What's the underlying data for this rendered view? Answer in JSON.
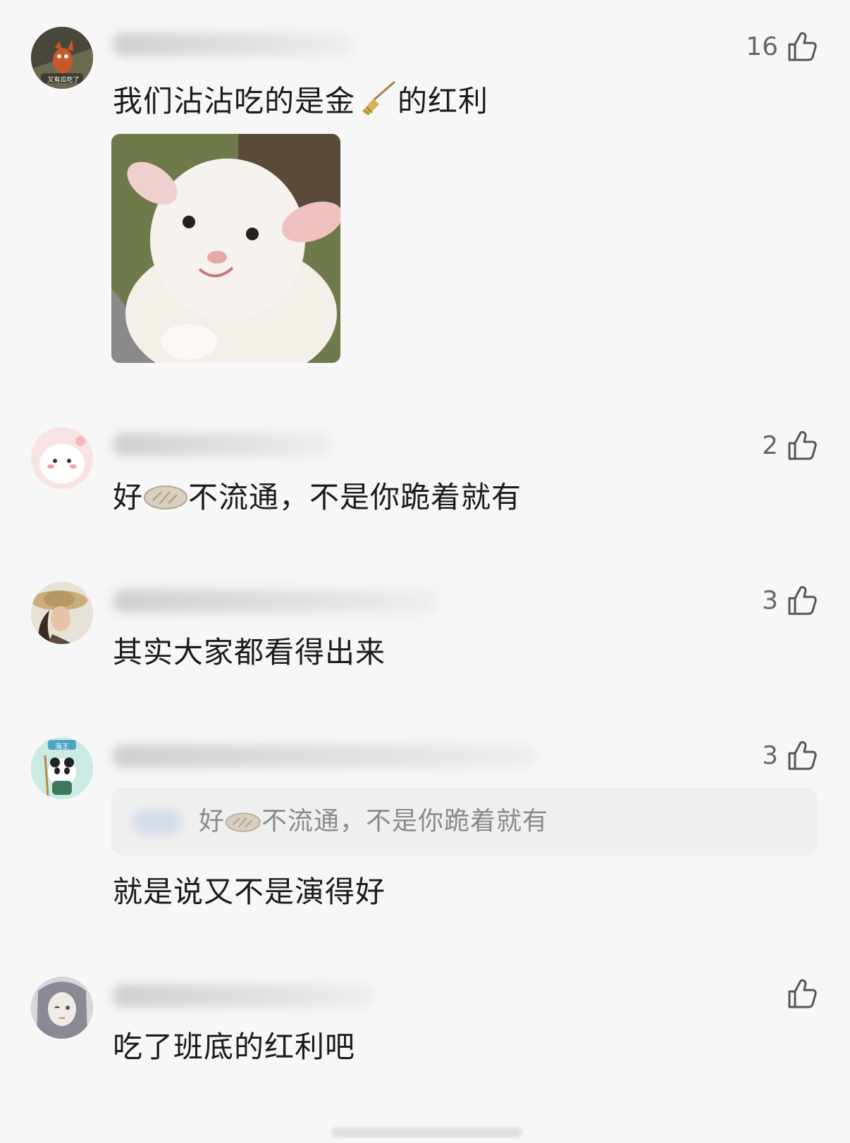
{
  "comments": [
    {
      "likes": "16",
      "text_before": "我们沾沾吃的是金",
      "inline_emoji": "broom-icon",
      "text_after": "的红利",
      "avatar_caption": "又有瓜吃了"
    },
    {
      "likes": "2",
      "text_before": "好",
      "inline_emoji": "pancake-icon",
      "text_after": "不流通，不是你跪着就有"
    },
    {
      "likes": "3",
      "text": "其实大家都看得出来"
    },
    {
      "likes": "3",
      "avatar_caption": "海王",
      "quote": {
        "text_before": "好",
        "inline_emoji": "pancake-icon",
        "text_after": "不流通，不是你跪着就有"
      },
      "text": "就是说又不是演得好"
    },
    {
      "likes": "",
      "text": "吃了班底的红利吧"
    }
  ]
}
